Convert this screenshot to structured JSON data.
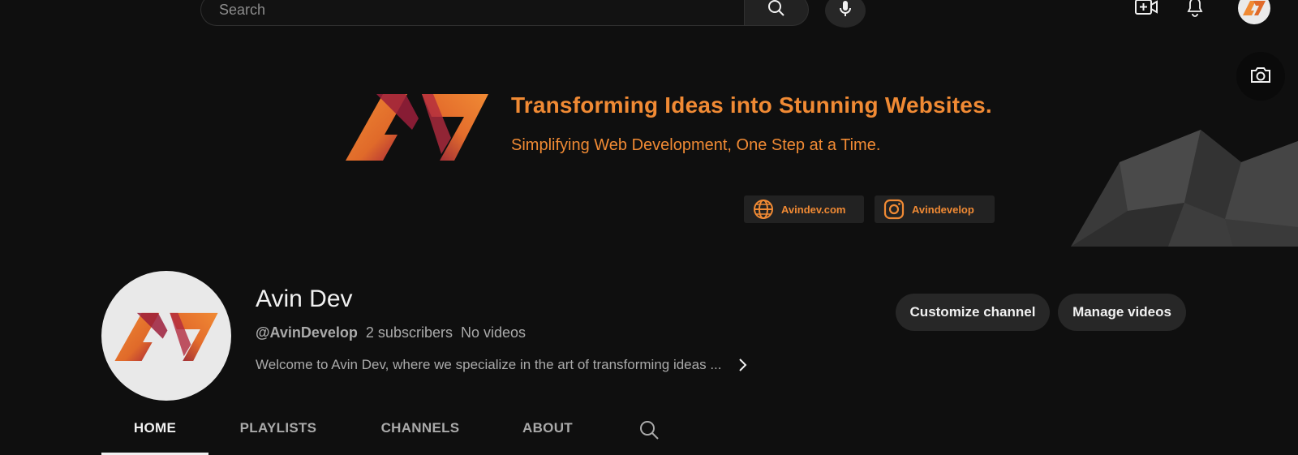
{
  "topbar": {
    "search_placeholder": "Search",
    "icons": [
      "search-icon",
      "microphone-icon",
      "create-video-icon",
      "notifications-bell-icon",
      "account-avatar"
    ]
  },
  "banner": {
    "headline": "Transforming Ideas into Stunning Websites.",
    "subheadline": "Simplifying Web Development, One Step at a Time.",
    "links": [
      {
        "label": "Avindev.com",
        "icon": "globe-icon"
      },
      {
        "label": "Avindevelop",
        "icon": "instagram-icon"
      }
    ],
    "accent_color": "#f08a34"
  },
  "channel": {
    "name": "Avin Dev",
    "handle": "@AvinDevelop",
    "subscribers": "2 subscribers",
    "videos": "No videos",
    "description": "Welcome to Avin Dev, where we specialize in the art of transforming ideas ...",
    "buttons": {
      "customize": "Customize channel",
      "manage": "Manage videos"
    }
  },
  "tabs": [
    {
      "label": "HOME",
      "active": true
    },
    {
      "label": "PLAYLISTS",
      "active": false
    },
    {
      "label": "CHANNELS",
      "active": false
    },
    {
      "label": "ABOUT",
      "active": false
    }
  ]
}
